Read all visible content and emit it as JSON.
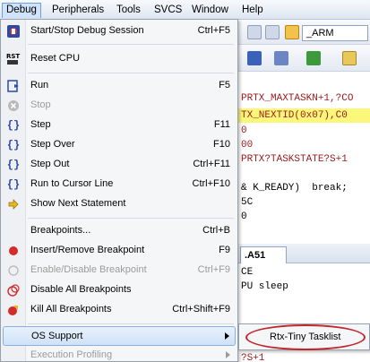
{
  "menubar": {
    "items": [
      "Debug",
      "Peripherals",
      "Tools",
      "SVCS",
      "Window",
      "Help"
    ]
  },
  "toolbar": {
    "target_value": "_ARM"
  },
  "code": {
    "lines": [
      {
        "text": "PRTX_MAXTASKN+1,?CO",
        "hl": false
      },
      {
        "text": "TX_NEXTID(0x07),C0",
        "hl": true
      },
      {
        "text": "0",
        "hl": false
      },
      {
        "text": "00",
        "hl": false
      },
      {
        "text": "PRTX?TASKSTATE?S+1",
        "hl": false
      },
      {
        "text": "",
        "hl": false
      },
      {
        "text": "& K_READY)  break;",
        "hl": false
      },
      {
        "text": "5C",
        "hl": false
      },
      {
        "text": "0",
        "hl": false
      }
    ],
    "tab_label": ".A51",
    "lower_lines": [
      "CE",
      "PU sleep"
    ],
    "bottom_line": "?S+1"
  },
  "menu": {
    "items": [
      {
        "label": "Start/Stop Debug Session",
        "shortcut": "Ctrl+F5",
        "icon": "debug-session-icon",
        "disabled": false
      },
      {
        "label": "Reset CPU",
        "shortcut": "",
        "icon": "reset-cpu-icon",
        "disabled": false
      },
      {
        "label": "Run",
        "shortcut": "F5",
        "icon": "run-icon",
        "disabled": false
      },
      {
        "label": "Stop",
        "shortcut": "",
        "icon": "stop-icon",
        "disabled": true
      },
      {
        "label": "Step",
        "shortcut": "F11",
        "icon": "step-icon",
        "disabled": false
      },
      {
        "label": "Step Over",
        "shortcut": "F10",
        "icon": "step-over-icon",
        "disabled": false
      },
      {
        "label": "Step Out",
        "shortcut": "Ctrl+F11",
        "icon": "step-out-icon",
        "disabled": false
      },
      {
        "label": "Run to Cursor Line",
        "shortcut": "Ctrl+F10",
        "icon": "run-to-cursor-icon",
        "disabled": false
      },
      {
        "label": "Show Next Statement",
        "shortcut": "",
        "icon": "arrow-right-icon",
        "disabled": false
      },
      {
        "label": "Breakpoints...",
        "shortcut": "Ctrl+B",
        "icon": "",
        "disabled": false
      },
      {
        "label": "Insert/Remove Breakpoint",
        "shortcut": "F9",
        "icon": "breakpoint-icon",
        "disabled": false
      },
      {
        "label": "Enable/Disable Breakpoint",
        "shortcut": "Ctrl+F9",
        "icon": "breakpoint-outline-icon",
        "disabled": true
      },
      {
        "label": "Disable All Breakpoints",
        "shortcut": "",
        "icon": "disable-breakpoints-icon",
        "disabled": false
      },
      {
        "label": "Kill All Breakpoints",
        "shortcut": "Ctrl+Shift+F9",
        "icon": "kill-breakpoints-icon",
        "disabled": false
      },
      {
        "label": "OS Support",
        "shortcut": "",
        "icon": "",
        "disabled": false
      },
      {
        "label": "Execution Profiling",
        "shortcut": "",
        "icon": "",
        "disabled": true
      }
    ]
  },
  "submenu": {
    "items": [
      {
        "label": "Rtx-Tiny Tasklist"
      }
    ]
  },
  "colors": {
    "highlight_yellow": "#fbf77a",
    "annotation_red": "#c0272d",
    "code_red": "#9c1b1b"
  }
}
